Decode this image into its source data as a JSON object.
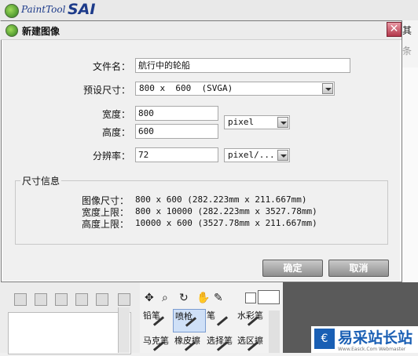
{
  "app": {
    "logo_painttool": "PaintTool",
    "logo_sai": "SAI",
    "right_text_1": "其",
    "right_text_2": "条"
  },
  "dialog": {
    "title": "新建图像",
    "close_glyph": "✕",
    "filename_label": "文件名：",
    "filename_value": "航行中的轮船",
    "preset_label": "预设尺寸：",
    "preset_value": "800 x  600  (SVGA)",
    "width_label": "宽度：",
    "width_value": "800",
    "height_label": "高度：",
    "height_value": "600",
    "unit_value": "pixel",
    "resolution_label": "分辨率：",
    "resolution_value": "72",
    "resolution_unit_value": "pixel/...",
    "info_title": "尺寸信息",
    "info": [
      {
        "label": "图像尺寸：",
        "value": "800 x 600  (282.223mm x 211.667mm)"
      },
      {
        "label": "宽度上限：",
        "value": "800 x 10000  (282.223mm x 3527.78mm)"
      },
      {
        "label": "高度上限：",
        "value": "10000 x 600  (3527.78mm x 211.667mm)"
      }
    ],
    "ok_label": "确定",
    "cancel_label": "取消"
  },
  "tools": {
    "brushes": [
      {
        "label": "铅笔",
        "icon": "pencil-icon"
      },
      {
        "label": "喷枪",
        "icon": "airbrush-icon"
      },
      {
        "label": "笔",
        "icon": "pen-icon"
      },
      {
        "label": "水彩笔",
        "icon": "watercolor-icon"
      },
      {
        "label": "马克笔",
        "icon": "marker-icon"
      },
      {
        "label": "橡皮擦",
        "icon": "eraser-icon"
      },
      {
        "label": "选择笔",
        "icon": "select-pen-icon"
      },
      {
        "label": "选区擦",
        "icon": "select-eraser-icon"
      }
    ],
    "icons": [
      "move-icon",
      "zoom-icon",
      "rotate-icon",
      "hand-icon",
      "eyedropper-icon"
    ]
  },
  "watermark": {
    "icon_glyph": "€",
    "title": "易采站长站",
    "subtitle": "Www.Easck.Com Webmaster"
  }
}
